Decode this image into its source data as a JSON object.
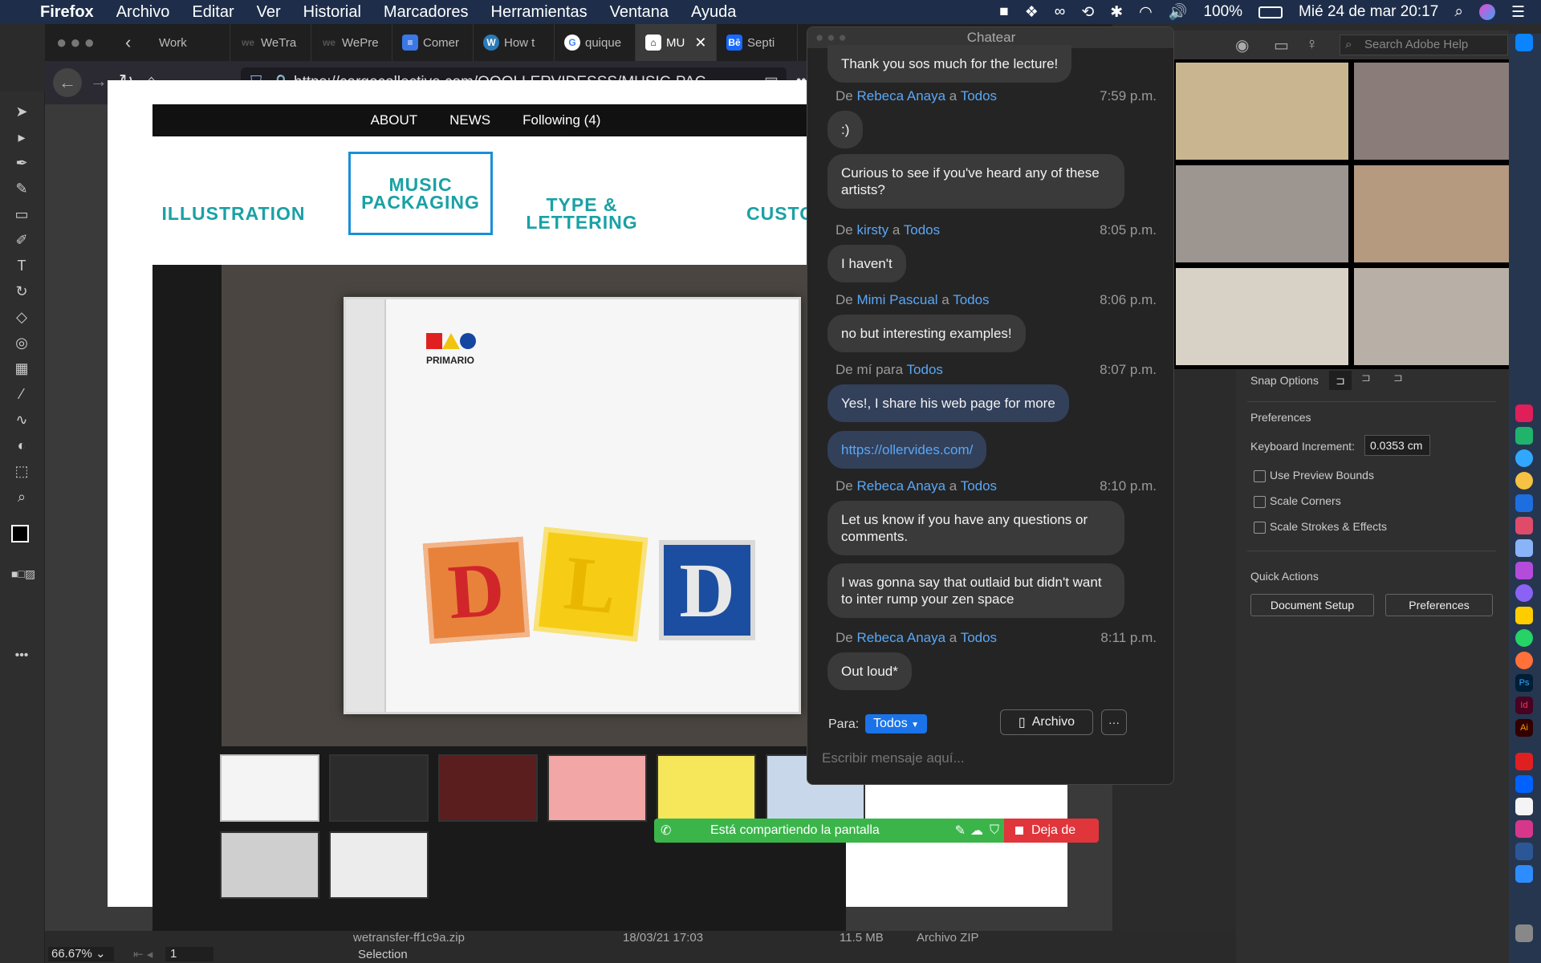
{
  "menubar": {
    "app": "Firefox",
    "items": [
      "Archivo",
      "Editar",
      "Ver",
      "Historial",
      "Marcadores",
      "Herramientas",
      "Ventana",
      "Ayuda"
    ],
    "battery": "100%",
    "datetime": "Mié 24 de mar  20:17"
  },
  "browser": {
    "tabs": [
      {
        "label": "Work",
        "icon": "generic"
      },
      {
        "label": "WeTra",
        "icon": "wetransfer"
      },
      {
        "label": "WePre",
        "icon": "wetransfer"
      },
      {
        "label": "Comer",
        "icon": "docs"
      },
      {
        "label": "How t",
        "icon": "wordpress"
      },
      {
        "label": "quique",
        "icon": "google"
      },
      {
        "label": "MU",
        "icon": "cargo",
        "active": true
      },
      {
        "label": "Septi",
        "icon": "behance"
      }
    ],
    "url": "https://cargocollective.com/OOOLLERVIDESSS/MUSIC-PAC"
  },
  "site": {
    "nav": [
      "ABOUT",
      "NEWS",
      "Following (4)"
    ],
    "categories": [
      "ILLUSTRATION",
      "MUSIC PACKAGING",
      "TYPE & LETTERING",
      "CUSTOM"
    ],
    "cd_brand": "PRIMARIO",
    "blocks": [
      "D",
      "L",
      "D"
    ]
  },
  "share": {
    "label": "Está compartiendo la pantalla",
    "stop": "Deja de"
  },
  "chat": {
    "title": "Chatear",
    "messages": [
      {
        "text": "Thank you sos much for the lecture!"
      },
      {
        "from": "Rebeca Anaya",
        "to": "Todos",
        "time": "7:59 p.m.",
        "text": ":)"
      },
      {
        "text": "Curious to see if you've heard any of these artists?"
      },
      {
        "from": "kirsty",
        "to": "Todos",
        "time": "8:05 p.m.",
        "text": "I haven't"
      },
      {
        "from": "Mimi Pascual",
        "to": "Todos",
        "time": "8:06 p.m.",
        "text": "no but interesting examples!"
      },
      {
        "from": "mí",
        "to": "Todos",
        "time": "8:07 p.m.",
        "text": "Yes!, I share his web page for more"
      },
      {
        "text": "https://ollervides.com/"
      },
      {
        "from": "Rebeca Anaya",
        "to": "Todos",
        "time": "8:10 p.m.",
        "text": "Let us know if you have any questions or comments."
      },
      {
        "text": "I was gonna say that outlaid but didn't want to inter rump your zen space"
      },
      {
        "from": "Rebeca Anaya",
        "to": "Todos",
        "time": "8:11 p.m.",
        "text": "Out loud*"
      }
    ],
    "to_label": "Para:",
    "to_value": "Todos",
    "file_button": "Archivo",
    "placeholder": "Escribir mensaje aquí...",
    "de": "De",
    "a": "a",
    "para": "para"
  },
  "illustrator": {
    "search_placeholder": "Search Adobe Help",
    "snap_options": "Snap Options",
    "preferences_heading": "Preferences",
    "keyboard_increment_label": "Keyboard Increment:",
    "keyboard_increment_value": "0.0353 cm",
    "checkboxes": [
      "Use Preview Bounds",
      "Scale Corners",
      "Scale Strokes & Effects"
    ],
    "quick_actions": "Quick Actions",
    "buttons": [
      "Document Setup",
      "Preferences"
    ],
    "zoom": "66.67%",
    "artboard": "1",
    "status": "Selection",
    "bottom_file": "wetransfer-ff1c9a.zip",
    "bottom_date": "18/03/21 17:03",
    "bottom_size": "11.5 MB",
    "bottom_kind": "Archivo ZIP"
  }
}
